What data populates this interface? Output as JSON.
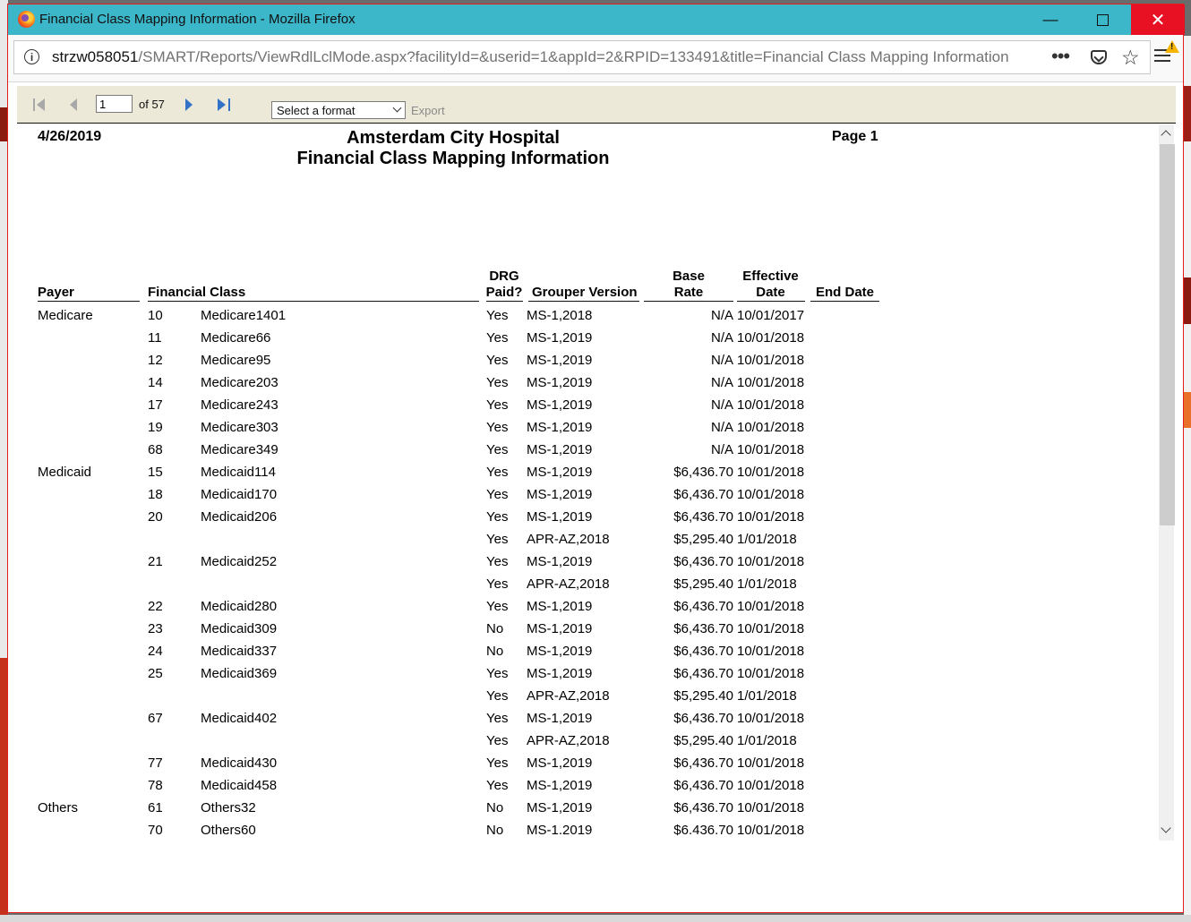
{
  "window": {
    "title": "Financial Class Mapping Information - Mozilla Firefox",
    "minimize_glyph": "—",
    "close_glyph": "✕"
  },
  "navbar": {
    "url_host": "strzw058051",
    "url_path": "/SMART/Reports/ViewRdlLclMode.aspx?facilityId=&userid=1&appId=2&RPID=133491&title=Financial Class Mapping Information",
    "info_glyph": "i",
    "overflow_glyph": "•••",
    "star_glyph": "☆",
    "warn_glyph": "!"
  },
  "toolbar": {
    "page_value": "1",
    "of_label": "of 57",
    "format_placeholder": "Select a format",
    "export_label": "Export"
  },
  "report": {
    "date": "4/26/2019",
    "hospital": "Amsterdam City Hospital",
    "title": "Financial Class Mapping Information",
    "page_label": "Page 1",
    "headers": {
      "payer": "Payer",
      "financial_class": "Financial Class",
      "drg_line1": "DRG",
      "drg_line2": "Paid?",
      "grouper_version": "Grouper Version",
      "base_line1": "Base",
      "base_line2": "Rate",
      "eff_line1": "Effective",
      "eff_line2": "Date",
      "end_date": "End Date"
    },
    "rows": [
      {
        "payer": "Medicare",
        "code": "10",
        "name": "Medicare1401",
        "drg": "Yes",
        "grouper": "MS-1,2018",
        "rate": "N/A",
        "effective": "10/01/2017"
      },
      {
        "payer": "",
        "code": "11",
        "name": "Medicare66",
        "drg": "Yes",
        "grouper": "MS-1,2019",
        "rate": "N/A",
        "effective": "10/01/2018"
      },
      {
        "payer": "",
        "code": "12",
        "name": "Medicare95",
        "drg": "Yes",
        "grouper": "MS-1,2019",
        "rate": "N/A",
        "effective": "10/01/2018"
      },
      {
        "payer": "",
        "code": "14",
        "name": "Medicare203",
        "drg": "Yes",
        "grouper": "MS-1,2019",
        "rate": "N/A",
        "effective": "10/01/2018"
      },
      {
        "payer": "",
        "code": "17",
        "name": "Medicare243",
        "drg": "Yes",
        "grouper": "MS-1,2019",
        "rate": "N/A",
        "effective": "10/01/2018"
      },
      {
        "payer": "",
        "code": "19",
        "name": "Medicare303",
        "drg": "Yes",
        "grouper": "MS-1,2019",
        "rate": "N/A",
        "effective": "10/01/2018"
      },
      {
        "payer": "",
        "code": "68",
        "name": "Medicare349",
        "drg": "Yes",
        "grouper": "MS-1,2019",
        "rate": "N/A",
        "effective": "10/01/2018"
      },
      {
        "payer": "Medicaid",
        "code": "15",
        "name": "Medicaid114",
        "drg": "Yes",
        "grouper": "MS-1,2019",
        "rate": "$6,436.70",
        "effective": "10/01/2018"
      },
      {
        "payer": "",
        "code": "18",
        "name": "Medicaid170",
        "drg": "Yes",
        "grouper": "MS-1,2019",
        "rate": "$6,436.70",
        "effective": "10/01/2018"
      },
      {
        "payer": "",
        "code": "20",
        "name": "Medicaid206",
        "drg": "Yes",
        "grouper": "MS-1,2019",
        "rate": "$6,436.70",
        "effective": "10/01/2018"
      },
      {
        "payer": "",
        "code": "",
        "name": "",
        "drg": "Yes",
        "grouper": "APR-AZ,2018",
        "rate": "$5,295.40",
        "effective": "1/01/2018"
      },
      {
        "payer": "",
        "code": "21",
        "name": "Medicaid252",
        "drg": "Yes",
        "grouper": "MS-1,2019",
        "rate": "$6,436.70",
        "effective": "10/01/2018"
      },
      {
        "payer": "",
        "code": "",
        "name": "",
        "drg": "Yes",
        "grouper": "APR-AZ,2018",
        "rate": "$5,295.40",
        "effective": "1/01/2018"
      },
      {
        "payer": "",
        "code": "22",
        "name": "Medicaid280",
        "drg": "Yes",
        "grouper": "MS-1,2019",
        "rate": "$6,436.70",
        "effective": "10/01/2018"
      },
      {
        "payer": "",
        "code": "23",
        "name": "Medicaid309",
        "drg": "No",
        "grouper": "MS-1,2019",
        "rate": "$6,436.70",
        "effective": "10/01/2018"
      },
      {
        "payer": "",
        "code": "24",
        "name": "Medicaid337",
        "drg": "No",
        "grouper": "MS-1,2019",
        "rate": "$6,436.70",
        "effective": "10/01/2018"
      },
      {
        "payer": "",
        "code": "25",
        "name": "Medicaid369",
        "drg": "Yes",
        "grouper": "MS-1,2019",
        "rate": "$6,436.70",
        "effective": "10/01/2018"
      },
      {
        "payer": "",
        "code": "",
        "name": "",
        "drg": "Yes",
        "grouper": "APR-AZ,2018",
        "rate": "$5,295.40",
        "effective": "1/01/2018"
      },
      {
        "payer": "",
        "code": "67",
        "name": "Medicaid402",
        "drg": "Yes",
        "grouper": "MS-1,2019",
        "rate": "$6,436.70",
        "effective": "10/01/2018"
      },
      {
        "payer": "",
        "code": "",
        "name": "",
        "drg": "Yes",
        "grouper": "APR-AZ,2018",
        "rate": "$5,295.40",
        "effective": "1/01/2018"
      },
      {
        "payer": "",
        "code": "77",
        "name": "Medicaid430",
        "drg": "Yes",
        "grouper": "MS-1,2019",
        "rate": "$6,436.70",
        "effective": "10/01/2018"
      },
      {
        "payer": "",
        "code": "78",
        "name": "Medicaid458",
        "drg": "Yes",
        "grouper": "MS-1,2019",
        "rate": "$6,436.70",
        "effective": "10/01/2018"
      },
      {
        "payer": "Others",
        "code": "61",
        "name": "Others32",
        "drg": "No",
        "grouper": "MS-1,2019",
        "rate": "$6,436.70",
        "effective": "10/01/2018"
      },
      {
        "payer": "",
        "code": "70",
        "name": "Others60",
        "drg": "No",
        "grouper": "MS-1.2019",
        "rate": "$6.436.70",
        "effective": "10/01/2018"
      }
    ]
  }
}
